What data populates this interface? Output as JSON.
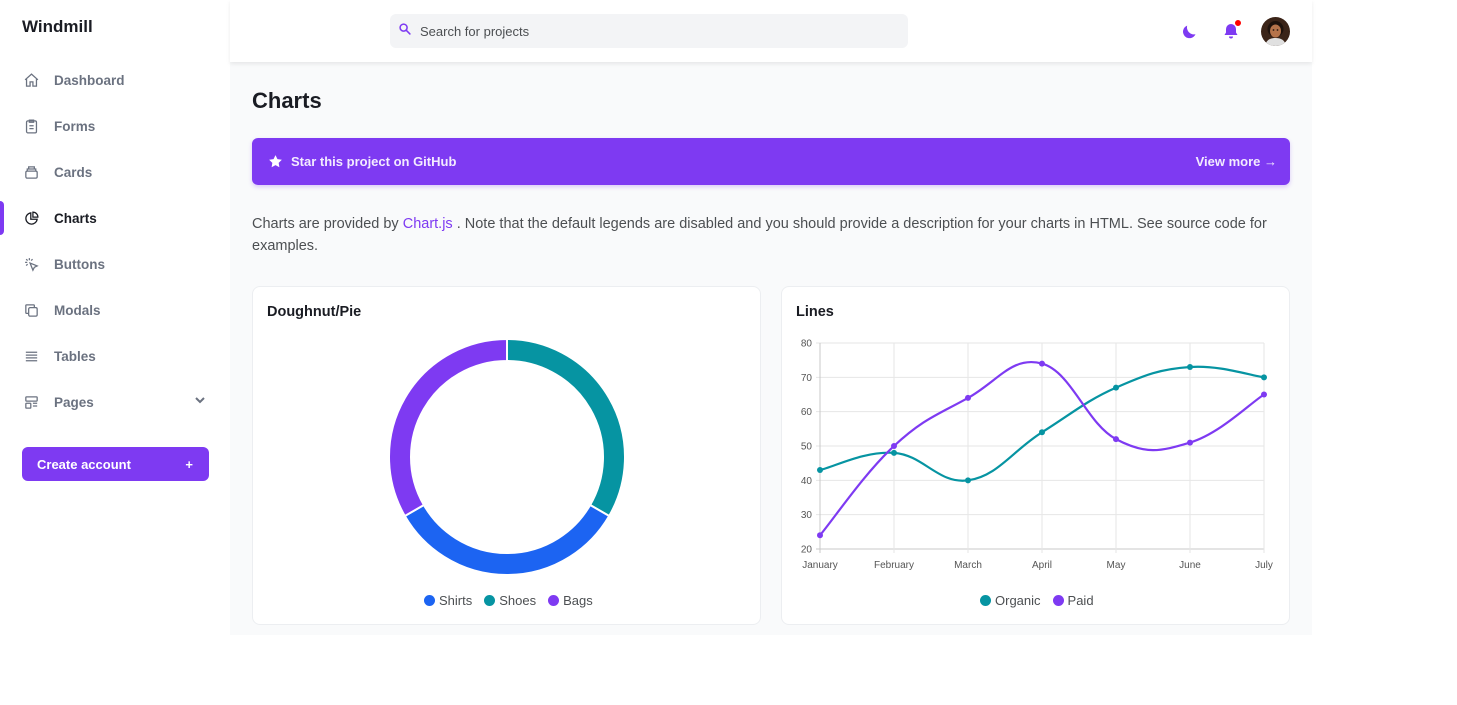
{
  "app": {
    "brand": "Windmill"
  },
  "sidebar": {
    "items": [
      {
        "label": "Dashboard",
        "icon": "home-icon"
      },
      {
        "label": "Forms",
        "icon": "clipboard-icon"
      },
      {
        "label": "Cards",
        "icon": "cards-icon"
      },
      {
        "label": "Charts",
        "icon": "pie-chart-icon",
        "active": true
      },
      {
        "label": "Buttons",
        "icon": "cursor-click-icon"
      },
      {
        "label": "Modals",
        "icon": "duplicate-icon"
      },
      {
        "label": "Tables",
        "icon": "table-icon"
      },
      {
        "label": "Pages",
        "icon": "template-icon",
        "has_dropdown": true
      }
    ],
    "create_account": {
      "label": "Create account",
      "suffix": "+"
    }
  },
  "header": {
    "search_placeholder": "Search for projects",
    "icons": [
      "moon-icon",
      "bell-icon",
      "avatar"
    ]
  },
  "main": {
    "title": "Charts",
    "banner": {
      "text": "Star this project on GitHub",
      "link": "View more →"
    },
    "description": {
      "before_link": "Charts are provided by ",
      "link": "Chart.js",
      "after_link": " . Note that the default legends are disabled and you should provide a description for your charts in HTML. See source code for examples."
    },
    "pie_card": {
      "title": "Doughnut/Pie"
    },
    "line_card": {
      "title": "Lines"
    }
  },
  "colors": {
    "purple": "#7e3af2",
    "teal": "#0694a2",
    "blue": "#1c64f2",
    "notification": "#ff0000"
  },
  "chart_data": [
    {
      "type": "pie",
      "title": "Doughnut/Pie",
      "categories": [
        "Shirts",
        "Shoes",
        "Bags"
      ],
      "values": [
        33,
        33,
        33
      ],
      "colors": [
        "#1c64f2",
        "#0694a2",
        "#7e3af2"
      ],
      "legend": "bottom"
    },
    {
      "type": "line",
      "title": "Lines",
      "categories": [
        "January",
        "February",
        "March",
        "April",
        "May",
        "June",
        "July"
      ],
      "series": [
        {
          "name": "Organic",
          "values": [
            43,
            48,
            40,
            54,
            67,
            73,
            70
          ],
          "color": "#0694a2"
        },
        {
          "name": "Paid",
          "values": [
            24,
            50,
            64,
            74,
            52,
            51,
            65
          ],
          "color": "#7e3af2"
        }
      ],
      "yticks": [
        20,
        30,
        40,
        50,
        60,
        70,
        80
      ],
      "ylim": [
        20,
        80
      ],
      "grid": true,
      "legend": "bottom"
    }
  ]
}
